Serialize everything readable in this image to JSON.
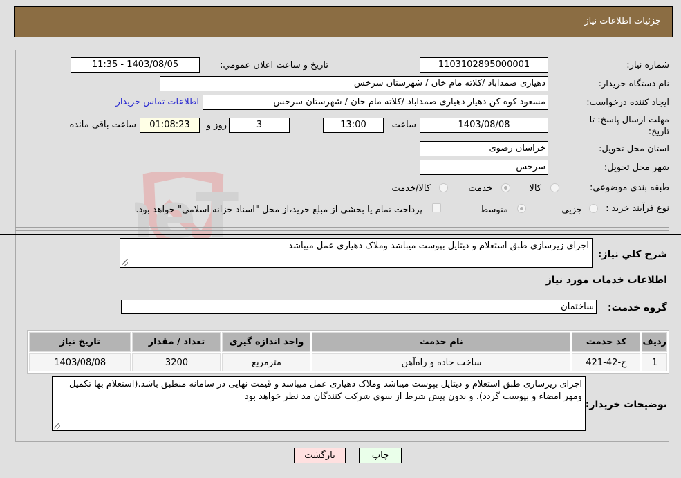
{
  "header": {
    "title": "جزئیات اطلاعات نیاز"
  },
  "form": {
    "need_number": {
      "label": "شماره نیاز:",
      "value": "1103102895000001"
    },
    "announce_datetime": {
      "label": "تاریخ و ساعت اعلان عمومي:",
      "value": "1403/08/05 - 11:35"
    },
    "buyer_org": {
      "label": "نام دستگاه خريدار:",
      "value": "دهیاری صمداباد /کلاته مام خان / شهرستان سرخس"
    },
    "requester": {
      "label": "ایجاد کننده درخواست:",
      "value": "مسعود کوه کن دهیار دهیاری صمداباد /کلاته مام خان / شهرستان سرخس"
    },
    "buyer_contact_link": "اطلاعات تماس خريدار",
    "deadline": {
      "label": "مهلت ارسال پاسخ: تا تاریخ:",
      "date": "1403/08/08",
      "time_label": "ساعت",
      "time": "13:00",
      "days": "3",
      "days_label": "روز و",
      "remaining": "01:08:23",
      "remaining_label": "ساعت باقي مانده"
    },
    "province": {
      "label": "استان محل تحویل:",
      "value": "خراسان رضوی"
    },
    "city": {
      "label": "شهر محل تحویل:",
      "value": "سرخس"
    },
    "category": {
      "label": "طبقه بندی موضوعی:",
      "options": [
        {
          "label": "کالا",
          "checked": false
        },
        {
          "label": "خدمت",
          "checked": true
        },
        {
          "label": "کالا/خدمت",
          "checked": false
        }
      ]
    },
    "purchase_type": {
      "label": "نوع فرآیند خرید :",
      "options": [
        {
          "label": "جزيي",
          "checked": false
        },
        {
          "label": "متوسط",
          "checked": true
        }
      ],
      "treasury_note": "پرداخت تمام یا بخشی از مبلغ خرید،از محل \"اسناد خزانه اسلامی\" خواهد بود.",
      "treasury_checked": false
    }
  },
  "general_description": {
    "label": "شرح کلي نياز:",
    "value": "اجرای زیرسازی طبق استعلام  و دیتایل بپوست میباشد وملاک دهیاری عمل میباشد"
  },
  "services_section": {
    "title": "اطلاعات خدمات مورد نیاز",
    "group_label": "گروه خدمت:",
    "group_value": "ساختمان"
  },
  "table": {
    "headers": [
      "رديف",
      "کد خدمت",
      "نام خدمت",
      "واحد اندازه گيری",
      "تعداد / مقدار",
      "تاریخ نیاز"
    ],
    "rows": [
      [
        "1",
        "ج-42-421",
        "ساخت جاده و راه‌آهن",
        "مترمربع",
        "3200",
        "1403/08/08"
      ]
    ]
  },
  "buyer_notes": {
    "label": "توضیحات خریدار:",
    "value": "اجرای زیرسازی طبق استعلام  و دیتایل بپوست میباشد وملاک دهیاری عمل میباشد و قیمت نهایی در سامانه منطبق باشد.(استعلام بها تکمیل ومهر امضاء و بپوست گردد). و بدون پیش شرط از سوی شرکت کنندگان مد نظر خواهد بود"
  },
  "buttons": {
    "print": "چاپ",
    "back": "بازگشت"
  },
  "watermark": "AriaTender.neT"
}
